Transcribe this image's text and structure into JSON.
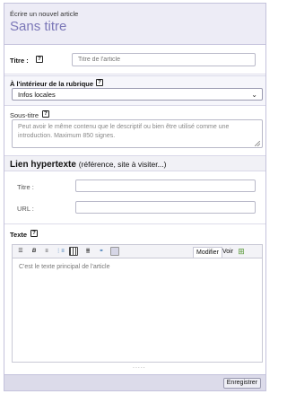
{
  "header": {
    "supertitle": "Écrire un nouvel article",
    "title": "Sans titre"
  },
  "titre": {
    "label": "Titre :",
    "placeholder": "Titre de l'article"
  },
  "rubrique": {
    "label": "À l'intérieur de la rubrique",
    "selected": "Infos locales"
  },
  "soustitre": {
    "label": "Sous-titre",
    "placeholder": "Peut avoir le même contenu que le descriptif ou bien être utilisé comme une introduction. Maximum 850 signes."
  },
  "lien": {
    "title": "Lien hypertexte",
    "subtitle": "(référence, site à visiter...)",
    "titre_label": "Titre :",
    "url_label": "URL :"
  },
  "texte": {
    "label": "Texte",
    "placeholder": "C'est le texte principal de l'article",
    "tabs": [
      "Modifier",
      "Voir"
    ],
    "toolbar_icons": [
      "heading-icon",
      "bold-icon",
      "list-icon",
      "ordered-list-icon",
      "table-icon",
      "paragraph-icon",
      "link-icon",
      "image-icon"
    ],
    "grip": "....."
  },
  "footer": {
    "save_label": "Enregistrer"
  },
  "help_glyph": "?",
  "colors": {
    "accent": "#7b77b8",
    "header_bg": "#edecf6",
    "footer_bg": "#dcdbea"
  }
}
